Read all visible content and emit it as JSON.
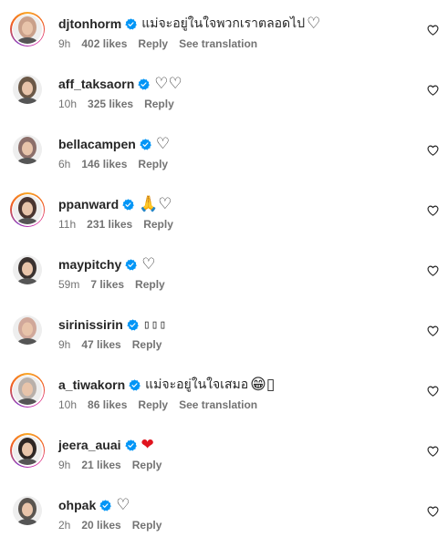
{
  "colors": {
    "verified": "#0095f6",
    "muted": "#737373",
    "text": "#262626",
    "red_heart": "#e0141e"
  },
  "comments": [
    {
      "username": "djtonhorm",
      "text": "แม่จะอยู่ในใจพวกเราตลอดไป",
      "emoji": "♡",
      "time": "9h",
      "likes": "402 likes",
      "reply": "Reply",
      "translation": "See translation",
      "story_ring": true,
      "avatar_color": "#c9a08a"
    },
    {
      "username": "aff_taksaorn",
      "text": "",
      "emoji": "♡♡",
      "time": "10h",
      "likes": "325 likes",
      "reply": "Reply",
      "translation": "",
      "story_ring": false,
      "avatar_color": "#6b5847"
    },
    {
      "username": "bellacampen",
      "text": "",
      "emoji": "♡",
      "time": "6h",
      "likes": "146 likes",
      "reply": "Reply",
      "translation": "",
      "story_ring": false,
      "avatar_color": "#8c6f6a"
    },
    {
      "username": "ppanward",
      "text": "",
      "emoji": "🙏♡",
      "time": "11h",
      "likes": "231 likes",
      "reply": "Reply",
      "translation": "",
      "story_ring": true,
      "avatar_color": "#4a3530"
    },
    {
      "username": "maypitchy",
      "text": "",
      "emoji": "♡",
      "time": "59m",
      "likes": "7 likes",
      "reply": "Reply",
      "translation": "",
      "story_ring": false,
      "avatar_color": "#3a3230"
    },
    {
      "username": "sirinissirin",
      "text": "",
      "emoji": "▯▯▯",
      "time": "9h",
      "likes": "47 likes",
      "reply": "Reply",
      "translation": "",
      "story_ring": false,
      "avatar_color": "#d0a89a"
    },
    {
      "username": "a_tiwakorn",
      "text": "แม่จะอยู่ในใจเสมอ",
      "emoji": "😁▯",
      "time": "10h",
      "likes": "86 likes",
      "reply": "Reply",
      "translation": "See translation",
      "story_ring": true,
      "avatar_color": "#b9b0aa"
    },
    {
      "username": "jeera_auai",
      "text": "",
      "emoji": "❤",
      "time": "9h",
      "likes": "21 likes",
      "reply": "Reply",
      "translation": "",
      "story_ring": true,
      "avatar_color": "#2e2624"
    },
    {
      "username": "ohpak",
      "text": "",
      "emoji": "♡",
      "time": "2h",
      "likes": "20 likes",
      "reply": "Reply",
      "translation": "",
      "story_ring": false,
      "avatar_color": "#5a5550"
    }
  ]
}
